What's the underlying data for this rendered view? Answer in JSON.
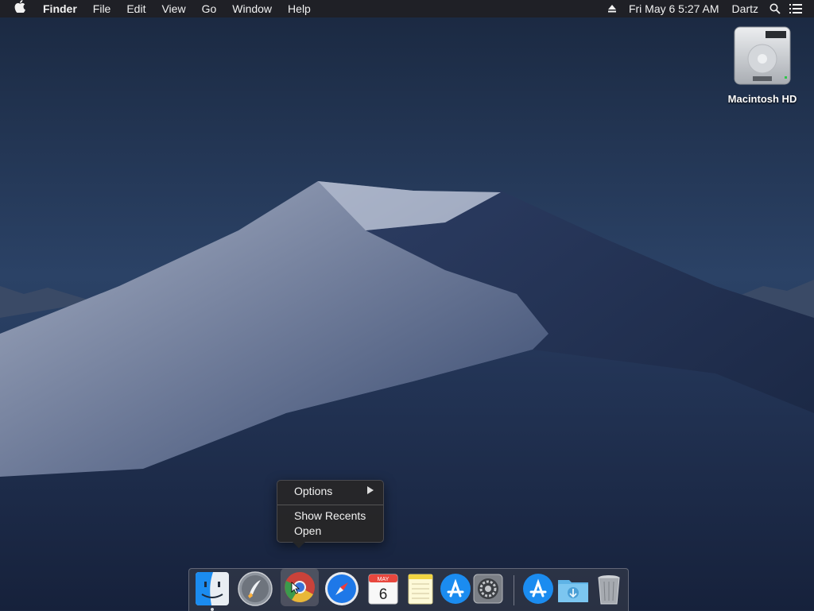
{
  "menubar": {
    "app_name": "Finder",
    "items": [
      "File",
      "Edit",
      "View",
      "Go",
      "Window",
      "Help"
    ],
    "clock": "Fri May 6  5:27 AM",
    "user": "Dartz"
  },
  "desktop": {
    "icons": [
      {
        "label": "Macintosh HD",
        "icon": "hard-drive-icon"
      }
    ]
  },
  "context_menu": {
    "items": [
      "Options",
      "Show Recents",
      "Open"
    ]
  },
  "dock": {
    "apps": [
      {
        "name": "Finder",
        "icon": "finder-icon"
      },
      {
        "name": "Launchpad",
        "icon": "launchpad-icon"
      },
      {
        "name": "Chrome",
        "icon": "chrome-icon"
      },
      {
        "name": "Safari",
        "icon": "safari-icon"
      },
      {
        "name": "Calendar",
        "icon": "calendar-icon",
        "month": "MAY",
        "day": "6"
      },
      {
        "name": "Notes",
        "icon": "notes-icon"
      },
      {
        "name": "App Store",
        "icon": "app-store-icon"
      },
      {
        "name": "System Preferences",
        "icon": "system-preferences-icon"
      },
      {
        "name": "App Store",
        "icon": "app-store-icon"
      },
      {
        "name": "Downloads",
        "icon": "downloads-folder-icon"
      },
      {
        "name": "Trash",
        "icon": "trash-icon"
      }
    ]
  },
  "colors": {
    "menubar_bg": "#202024",
    "accent_blue": "#1b8cf0",
    "wallpaper_sky": "#22365a"
  }
}
